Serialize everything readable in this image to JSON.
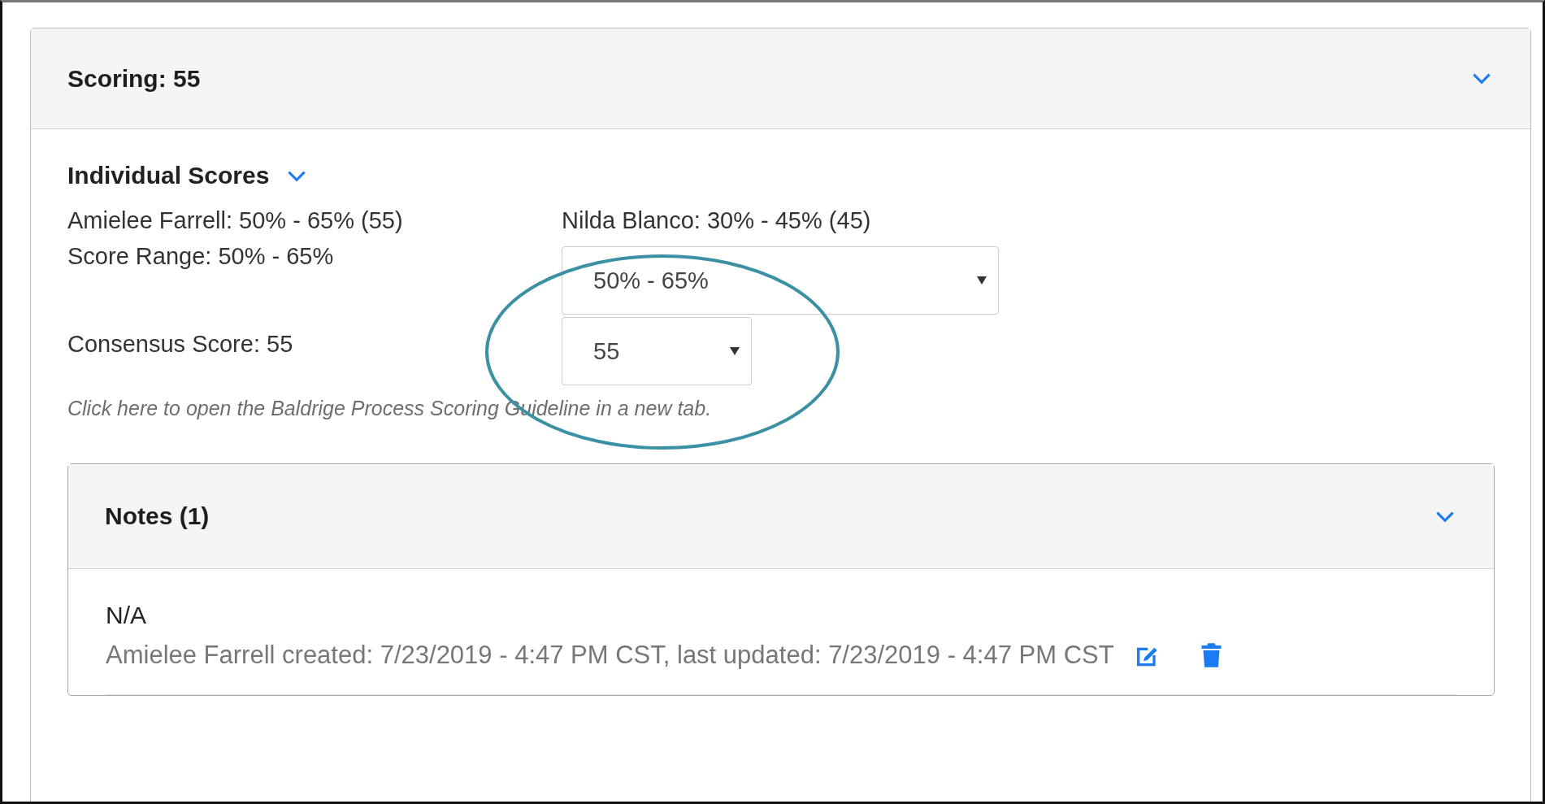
{
  "scoring": {
    "title": "Scoring: 55",
    "expanded": true
  },
  "individual_scores": {
    "title": "Individual Scores",
    "expanded": true,
    "scores": [
      "Amielee Farrell: 50% - 65% (55)",
      "Nilda Blanco: 30% - 45% (45)"
    ],
    "score_range": {
      "label": "Score Range: 50% - 65%",
      "value": "50% - 65%"
    },
    "consensus_score": {
      "label": "Consensus Score: 55",
      "value": "55"
    },
    "guideline_link": "Click here to open the Baldrige Process Scoring Guideline in a new tab."
  },
  "notes": {
    "title": "Notes (1)",
    "expanded": true,
    "items": [
      {
        "text": "N/A",
        "meta": "Amielee Farrell created: 7/23/2019 - 4:47 PM CST, last updated: 7/23/2019 - 4:47 PM CST"
      }
    ]
  }
}
